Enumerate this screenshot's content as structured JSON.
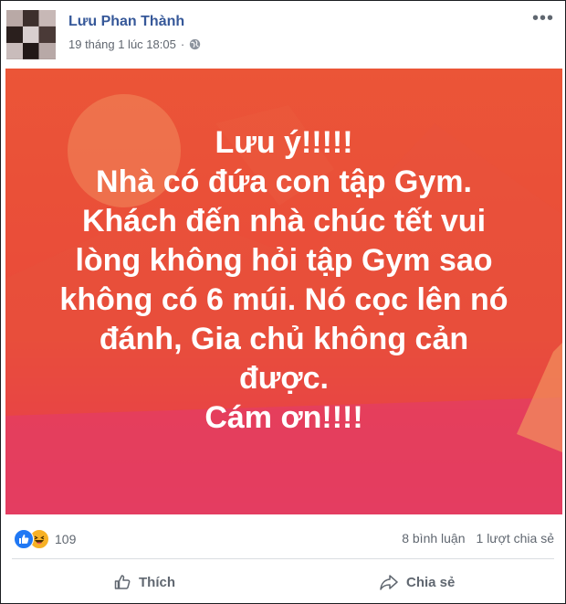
{
  "post": {
    "author": "Lưu Phan Thành",
    "timestamp": "19 tháng 1 lúc 18:05",
    "more_icon": "ellipsis-icon",
    "privacy_icon": "globe-icon"
  },
  "image_text": {
    "lines": [
      "Lưu ý!!!!!",
      "Nhà có đứa con tập Gym.",
      "Khách đến nhà chúc tết vui",
      "lòng không hỏi tập Gym sao",
      "không có 6 múi. Nó cọc lên nó",
      "đánh, Gia chủ không cản",
      "được.",
      "Cám ơn!!!!"
    ],
    "colors": {
      "top": "#eb5537",
      "bottom": "#e42e6b",
      "text": "#ffffff"
    }
  },
  "footer": {
    "reaction_icons": [
      "like-icon",
      "haha-icon"
    ],
    "reaction_count": "109",
    "comments": "8 bình luận",
    "shares": "1 lượt chia sẻ",
    "like_label": "Thích",
    "share_label": "Chia sẻ"
  },
  "colors": {
    "author": "#365899",
    "meta": "#616770",
    "like_blue": "#2078f4",
    "haha_yellow": "#f7b125"
  }
}
